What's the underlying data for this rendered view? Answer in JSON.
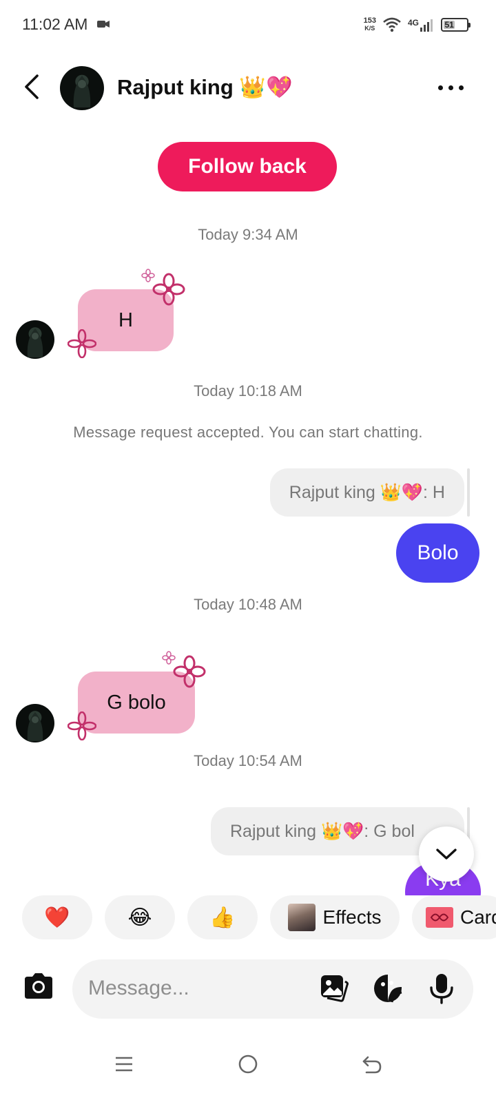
{
  "status_bar": {
    "time": "11:02 AM",
    "net_speed_top": "153",
    "net_speed_unit": "K/S",
    "network": "4G",
    "battery": "51",
    "battery_level_pct": 51
  },
  "header": {
    "contact_name": "Rajput king 👑💖",
    "back_icon": "chevron-left-icon",
    "more_icon": "more-horizontal-icon"
  },
  "follow_back_label": "Follow back",
  "conversation": {
    "ts1": "Today 9:34 AM",
    "msg1": "H",
    "ts2": "Today 10:18 AM",
    "system_message": "Message request accepted. You can start chatting.",
    "reply1_quote": "Rajput king 👑💖: H",
    "out1": "Bolo",
    "ts3": "Today 10:48 AM",
    "msg2": "G bolo",
    "ts4": "Today 10:54 AM",
    "reply2_quote": "Rajput king 👑💖: G bol",
    "out2": "Kya"
  },
  "quick_reactions": {
    "heart": "❤️",
    "laugh": "😂",
    "thumbs": "👍",
    "effects_label": "Effects",
    "cards_label": "Card"
  },
  "composer": {
    "placeholder": "Message..."
  },
  "colors": {
    "follow_back": "#ee1b5b",
    "incoming_bubble": "#f2b1c9",
    "outgoing_blue": "#4a43f0",
    "outgoing_purple": "#8a3cf0"
  }
}
